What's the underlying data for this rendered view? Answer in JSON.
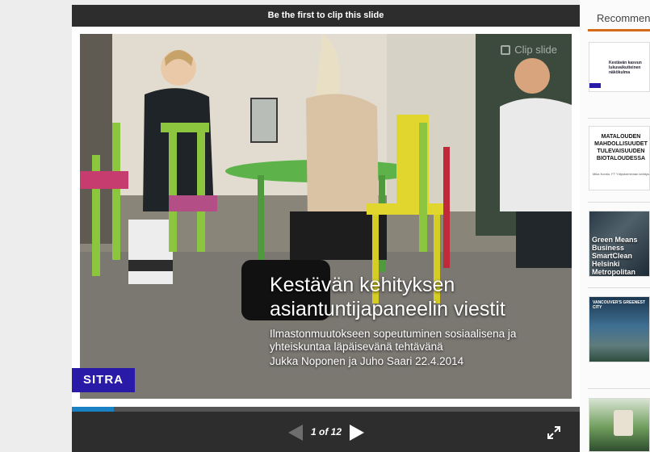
{
  "player": {
    "clip_banner": "Be the first to clip this slide",
    "clip_overlay": "Clip slide",
    "slide": {
      "title": "Kestävän kehityksen asiantuntijapaneelin viestit",
      "subtitle": "Ilmastonmuutokseen sopeutuminen sosiaalisena ja yhteiskuntaa läpäisevänä tehtävänä",
      "author": "Jukka Noponen ja Juho Saari 22.4.2014",
      "logo_text": "SITRA",
      "image_icon": "outdoor-cafe-photo"
    },
    "progress_fraction": 0.083,
    "counter": "1 of 12",
    "icons": {
      "prev": "prev-arrow-icon",
      "next": "next-arrow-icon",
      "fullscreen": "fullscreen-icon",
      "clip": "pin-icon"
    },
    "colors": {
      "accent": "#1a81c4",
      "bar": "#2d2d2d",
      "brand": "#2a1aa8"
    }
  },
  "recommended": {
    "header": "Recommended",
    "accent_color": "#d76a18",
    "items": [
      {
        "thumb_text": "Kestävän kasvun lukuvaikutteinen näkökulma"
      },
      {
        "thumb_text": "MATALOUDEN MAHDOLLISUUDET TULEVAISUUDEN BIOTALOUDESSA",
        "thumb_small": "Mika Kontio, FT Yritystoiminnan kehitys"
      },
      {
        "thumb_text": "Green Means Business SmartClean Helsinki Metropolitan"
      },
      {
        "thumb_text": "VANCOUVER'S GREENEST CITY"
      },
      {
        "thumb_text": ""
      }
    ]
  }
}
